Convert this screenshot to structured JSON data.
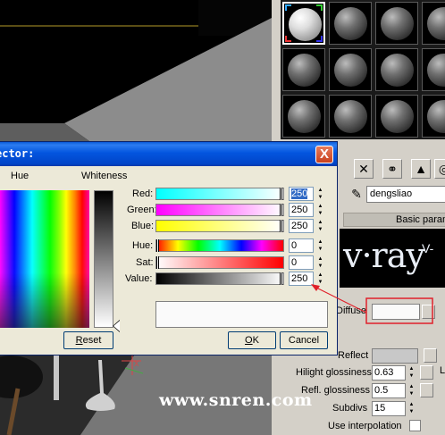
{
  "dialog": {
    "title": "ector:",
    "close_glyph": "X",
    "hue_label": "Hue",
    "whiteness_label": "Whiteness",
    "rows": [
      {
        "label": "Red:",
        "value": "250",
        "selected": true
      },
      {
        "label": "Green:",
        "value": "250"
      },
      {
        "label": "Blue:",
        "value": "250"
      },
      {
        "label": "Hue:",
        "value": "0"
      },
      {
        "label": "Sat:",
        "value": "0"
      },
      {
        "label": "Value:",
        "value": "250"
      }
    ],
    "reset_label": "eset",
    "reset_mnemonic": "R",
    "ok_label": "K",
    "ok_mnemonic": "O",
    "cancel_label": "Cancel"
  },
  "material_editor": {
    "material_name": "dengsliao",
    "rollout_title": "Basic param",
    "logo_text": "v·ray",
    "logo_suffix": "V-",
    "diffuse_label": "Diffuse",
    "reflect_label": "Reflect",
    "hilight_label": "Hilight glossiness",
    "hilight_value": "0.63",
    "refl_label": "Refl. glossiness",
    "refl_value": "0.5",
    "subdivs_label": "Subdivs",
    "subdivs_value": "15",
    "interp_label": "Use interpolation",
    "l_label": "L"
  },
  "watermark": "www.snren.com",
  "colors": {
    "selected_color": "#fafafa",
    "title_blue": "#0355df",
    "annotation_red": "#e0202a"
  },
  "icons": [
    "close-icon",
    "delete-icon",
    "material-link-icon",
    "eyedropper-icon",
    "spinner-icon",
    "pointer-arrow-icon"
  ]
}
